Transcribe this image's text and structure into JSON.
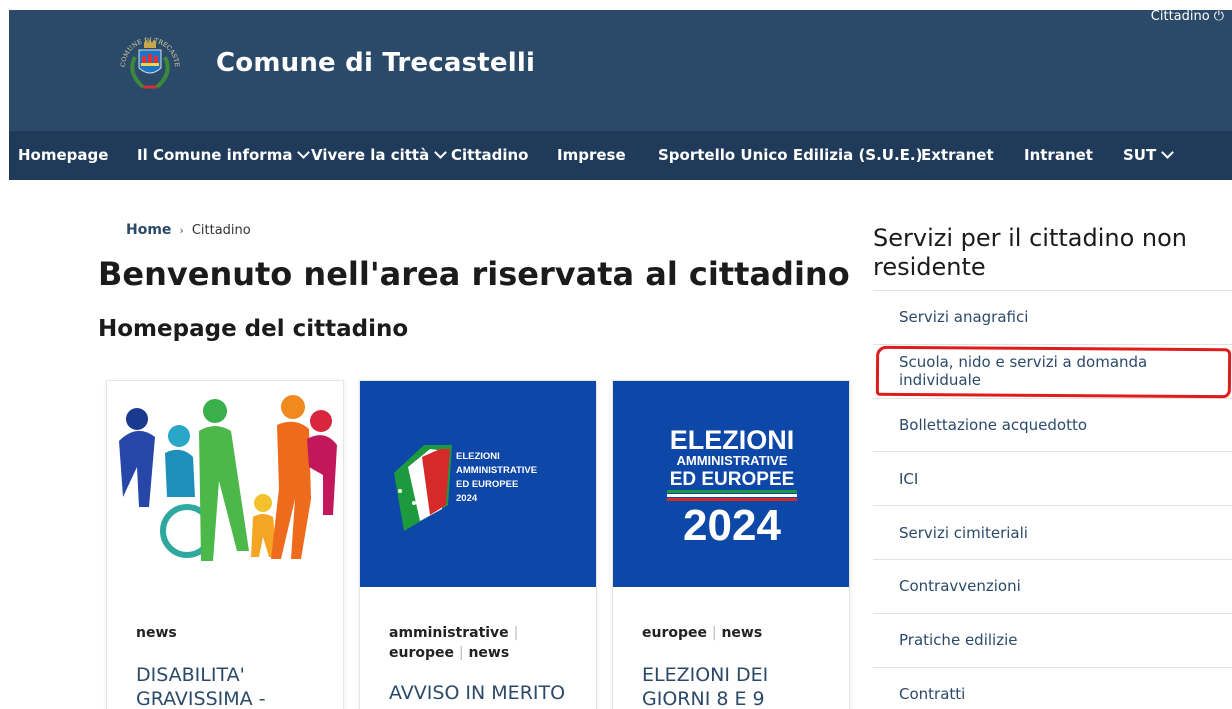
{
  "header": {
    "site_title": "Comune di Trecastelli",
    "user_label": "Cittadino",
    "logo_text": "COMUNE DI TRECASTELLI"
  },
  "nav": {
    "items": [
      {
        "label": "Homepage",
        "dropdown": false
      },
      {
        "label": "Il Comune informa",
        "dropdown": true
      },
      {
        "label": "Vivere la città",
        "dropdown": true
      },
      {
        "label": "Cittadino",
        "dropdown": false
      },
      {
        "label": "Imprese",
        "dropdown": false
      },
      {
        "label": "Sportello Unico Edilizia (S.U.E.)",
        "dropdown": false
      },
      {
        "label": "Extranet",
        "dropdown": false
      },
      {
        "label": "Intranet",
        "dropdown": false
      },
      {
        "label": "SUT",
        "dropdown": true
      }
    ]
  },
  "breadcrumb": {
    "home": "Home",
    "separator": "›",
    "current": "Cittadino"
  },
  "main": {
    "title": "Benvenuto nell'area riservata al cittadino",
    "subtitle": "Homepage del cittadino"
  },
  "cards": [
    {
      "tags": [
        {
          "text": "news"
        }
      ],
      "title_lines": [
        "DISABILITA'",
        "GRAVISSIMA -"
      ]
    },
    {
      "image_text": [
        "ELEZIONI",
        "AMMINISTRATIVE",
        "ED EUROPEE",
        "2024"
      ],
      "tags": [
        {
          "text": "amministrative",
          "sep": true
        },
        {
          "text": "europee",
          "sep": true
        },
        {
          "text": "news"
        }
      ],
      "title_lines": [
        "AVVISO IN MERITO"
      ]
    },
    {
      "image_text": [
        "ELEZIONI",
        "AMMINISTRATIVE",
        "ED EUROPEE",
        "2024"
      ],
      "tags": [
        {
          "text": "europee",
          "sep": true
        },
        {
          "text": "news"
        }
      ],
      "title_lines": [
        "ELEZIONI DEI",
        "GIORNI 8 E 9"
      ]
    }
  ],
  "sidebar": {
    "title": "Servizi per il cittadino non residente",
    "items": [
      {
        "label": "Servizi anagrafici"
      },
      {
        "label": "Scuola, nido e servizi a domanda individuale",
        "highlighted": true
      },
      {
        "label": "Bollettazione acquedotto"
      },
      {
        "label": "ICI"
      },
      {
        "label": "Servizi cimiteriali"
      },
      {
        "label": "Contravvenzioni"
      },
      {
        "label": "Pratiche edilizie"
      },
      {
        "label": "Contratti"
      }
    ]
  },
  "colors": {
    "header_bg": "#2b4a69",
    "nav_bg": "#1f3b59",
    "accent": "#2b4a69",
    "election_blue": "#0d47a8",
    "highlight": "#e01b1b"
  }
}
